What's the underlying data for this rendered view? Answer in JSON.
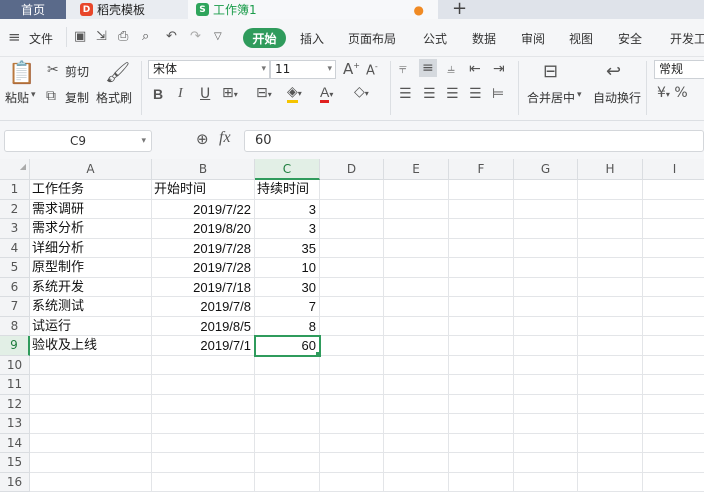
{
  "tabs": {
    "home": "首页",
    "templates": "稻壳模板",
    "workbook": "工作簿1",
    "add": "+"
  },
  "menu": {
    "file": "文件",
    "items": [
      "开始",
      "插入",
      "页面布局",
      "公式",
      "数据",
      "审阅",
      "视图",
      "安全",
      "开发工"
    ]
  },
  "toolbar": {
    "paste": "粘贴",
    "cut": "剪切",
    "copy": "复制",
    "format_painter": "格式刷",
    "font_name": "宋体",
    "font_size": "11",
    "merge_center": "合并居中",
    "wrap_text": "自动换行",
    "number_format": "常规",
    "font_color": "#e02020",
    "fill_color": "#f5c400"
  },
  "formula_bar": {
    "cell_ref": "C9",
    "fx": "fx",
    "value": "60"
  },
  "sheet": {
    "columns": [
      "A",
      "B",
      "C",
      "D",
      "E",
      "F",
      "G",
      "H",
      "I"
    ],
    "rows": [
      "1",
      "2",
      "3",
      "4",
      "5",
      "6",
      "7",
      "8",
      "9",
      "10",
      "11",
      "12",
      "13",
      "14",
      "15",
      "16"
    ],
    "headers": [
      "工作任务",
      "开始时间",
      "持续时间"
    ],
    "data": [
      [
        "需求调研",
        "2019/7/22",
        "3"
      ],
      [
        "需求分析",
        "2019/8/20",
        "3"
      ],
      [
        "详细分析",
        "2019/7/28",
        "35"
      ],
      [
        "原型制作",
        "2019/7/28",
        "10"
      ],
      [
        "系统开发",
        "2019/7/18",
        "30"
      ],
      [
        "系统测试",
        "2019/7/8",
        "7"
      ],
      [
        "试运行",
        "2019/8/5",
        "8"
      ],
      [
        "验收及上线",
        "2019/7/1",
        "60"
      ]
    ],
    "selected_cell": "C9"
  },
  "colors": {
    "accent": "#2f9b5c",
    "tab_home_bg": "#5a6a8a"
  }
}
